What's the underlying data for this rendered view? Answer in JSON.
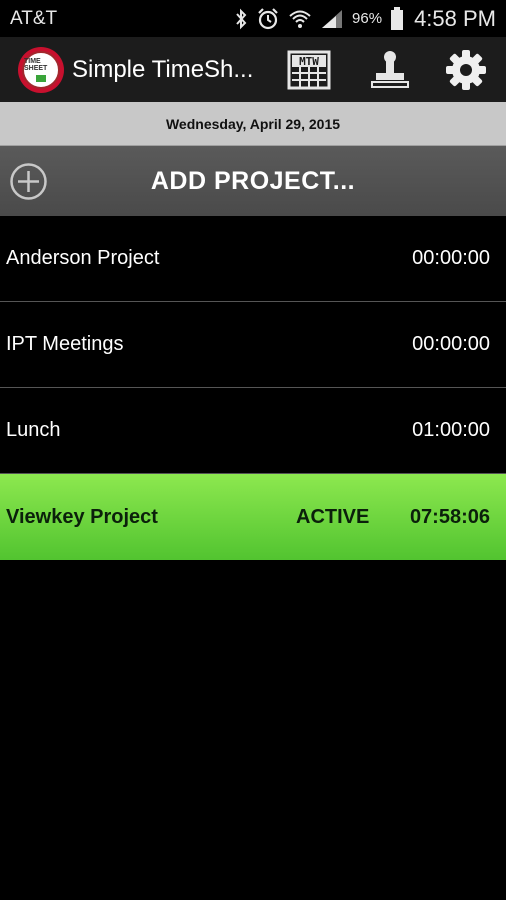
{
  "status_bar": {
    "carrier": "AT&T",
    "battery_percent": "96%",
    "time": "4:58 PM",
    "icons": [
      "bluetooth-icon",
      "alarm-icon",
      "wifi-icon",
      "signal-icon",
      "battery-icon"
    ]
  },
  "action_bar": {
    "title": "Simple TimeSh...",
    "logo_text": "TIME SHEET",
    "actions": [
      "week-view-icon",
      "stamp-icon",
      "gear-icon"
    ],
    "week_icon_text": "MTW"
  },
  "date_bar": {
    "date": "Wednesday, April 29, 2015"
  },
  "add_project": {
    "label": "ADD PROJECT...",
    "icon": "plus-circle-icon"
  },
  "projects": [
    {
      "name": "Anderson Project",
      "status": "",
      "time": "00:00:00",
      "active": false
    },
    {
      "name": "IPT Meetings",
      "status": "",
      "time": "00:00:00",
      "active": false
    },
    {
      "name": "Lunch",
      "status": "",
      "time": "01:00:00",
      "active": false
    },
    {
      "name": "Viewkey Project",
      "status": "ACTIVE",
      "time": "07:58:06",
      "active": true
    }
  ],
  "colors": {
    "active_row": "#66d23c",
    "action_bar": "#1c1c1c",
    "date_bar": "#c8c8c8",
    "add_bar": "#525252"
  }
}
